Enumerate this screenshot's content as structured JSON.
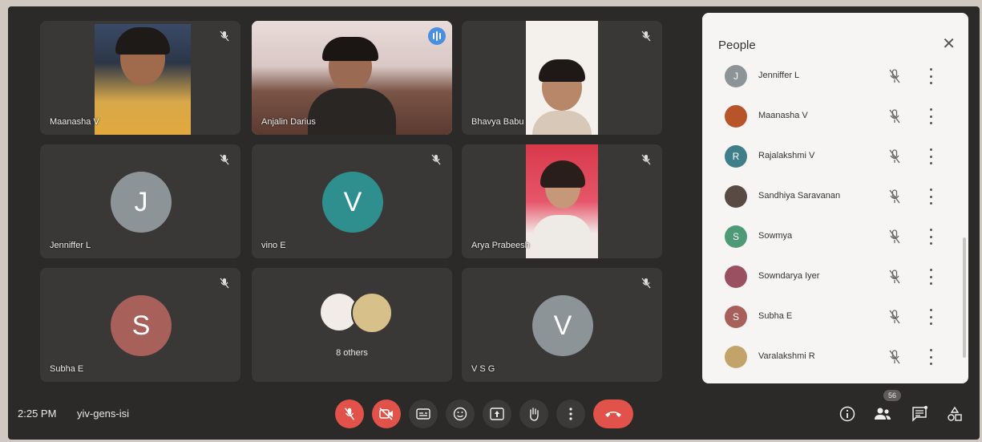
{
  "meeting": {
    "time": "2:25 PM",
    "code": "yiv-gens-isi"
  },
  "participants_count": "56",
  "tiles": [
    {
      "name": "Maanasha V"
    },
    {
      "name": "Anjalin Darius"
    },
    {
      "name": "Bhavya Babu"
    },
    {
      "name": "Jenniffer L",
      "initial": "J",
      "color": "#8d9498"
    },
    {
      "name": "vino E",
      "initial": "V",
      "color": "#2f8f8f"
    },
    {
      "name": "Arya Prabeesh"
    },
    {
      "name": "Subha E",
      "initial": "S",
      "color": "#a8605a"
    },
    {
      "name": "8 others"
    },
    {
      "name": "V S G",
      "initial": "V",
      "color": "#8d9498"
    }
  ],
  "people_panel": {
    "title": "People",
    "items": [
      {
        "name": "Jenniffer L",
        "initial": "J",
        "color": "#8d9498"
      },
      {
        "name": "Maanasha V",
        "initial": "",
        "color": "#b8542a"
      },
      {
        "name": "Rajalakshmi V",
        "initial": "R",
        "color": "#3f7f8a"
      },
      {
        "name": "Sandhiya Saravanan",
        "initial": "",
        "color": "#5a4a44"
      },
      {
        "name": "Sowmya",
        "initial": "S",
        "color": "#4f9a76"
      },
      {
        "name": "Sowndarya Iyer",
        "initial": "",
        "color": "#9a5060"
      },
      {
        "name": "Subha E",
        "initial": "S",
        "color": "#a8605a"
      },
      {
        "name": "Varalakshmi R",
        "initial": "",
        "color": "#c2a46a"
      }
    ]
  },
  "colors": {
    "end_call": "#e0524a",
    "active_outline": "#8fb3e8"
  }
}
